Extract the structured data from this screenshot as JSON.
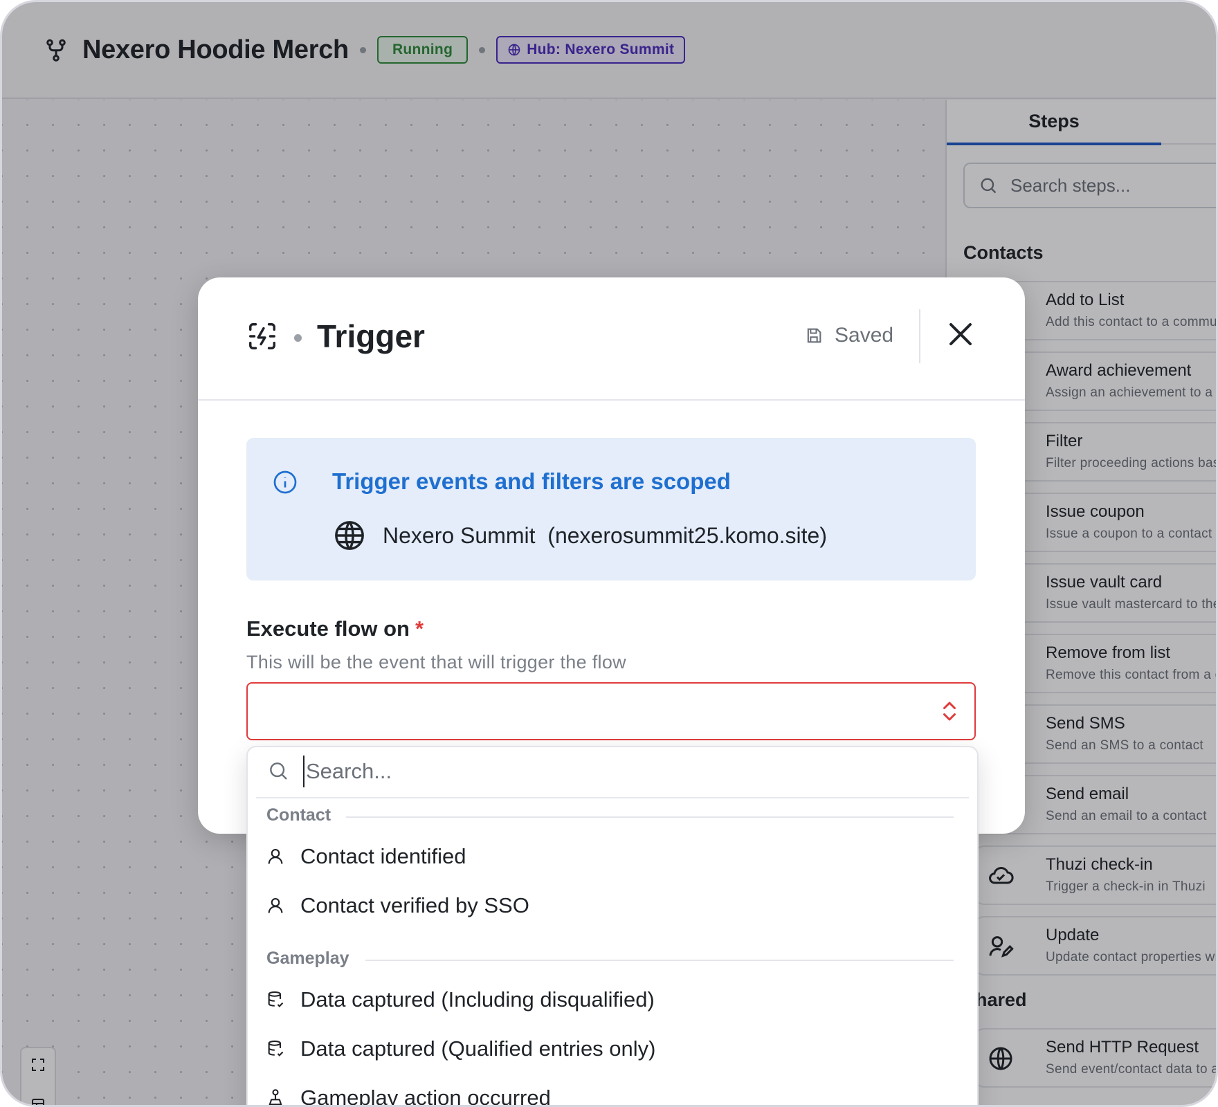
{
  "header": {
    "title": "Nexero Hoodie Merch",
    "status": "Running",
    "hub_label": "Hub: Nexero Summit",
    "status_color": "#2e8b3a",
    "hub_color": "#4b2bbf"
  },
  "steps_panel": {
    "tab_label": "Steps",
    "search_placeholder": "Search steps...",
    "sections": [
      {
        "title": "Contacts",
        "items": [
          {
            "title": "Add to List",
            "desc": "Add this contact to a community list",
            "icon": "list-add-icon"
          },
          {
            "title": "Award achievement",
            "desc": "Assign an achievement to a contact",
            "icon": "award-icon"
          },
          {
            "title": "Filter",
            "desc": "Filter proceeding actions based on conditions",
            "icon": "filter-icon"
          },
          {
            "title": "Issue coupon",
            "desc": "Issue a coupon to a contact",
            "icon": "coupon-icon"
          },
          {
            "title": "Issue vault card",
            "desc": "Issue vault mastercard to the contact",
            "icon": "card-icon"
          },
          {
            "title": "Remove from list",
            "desc": "Remove this contact from a community list",
            "icon": "list-remove-icon"
          },
          {
            "title": "Send SMS",
            "desc": "Send an SMS to a contact",
            "icon": "sms-icon"
          },
          {
            "title": "Send email",
            "desc": "Send an email to a contact",
            "icon": "mail-icon"
          },
          {
            "title": "Thuzi check-in",
            "desc": "Trigger a check-in in Thuzi",
            "icon": "cloud-icon"
          },
          {
            "title": "Update",
            "desc": "Update contact properties with values",
            "icon": "user-edit-icon"
          }
        ]
      },
      {
        "title": "Shared",
        "items": [
          {
            "title": "Send HTTP Request",
            "desc": "Send event/contact data to a URL",
            "icon": "globe-icon"
          }
        ]
      }
    ]
  },
  "modal": {
    "title": "Trigger",
    "saved_label": "Saved",
    "info": {
      "title": "Trigger events and filters are scoped",
      "site": "Nexero Summit  (nexerosummit25.komo.site)",
      "title_color": "#1f6fd0"
    },
    "field": {
      "label": "Execute flow on",
      "required_mark": "*",
      "help": "This will be the event that will trigger the flow",
      "value": ""
    }
  },
  "dropdown": {
    "search_placeholder": "Search...",
    "groups": [
      {
        "label": "Contact",
        "items": [
          {
            "label": "Contact identified",
            "icon": "user-icon"
          },
          {
            "label": "Contact verified by SSO",
            "icon": "user-icon"
          }
        ]
      },
      {
        "label": "Gameplay",
        "items": [
          {
            "label": "Data captured (Including disqualified)",
            "icon": "database-check-icon"
          },
          {
            "label": "Data captured (Qualified entries only)",
            "icon": "database-check-icon"
          },
          {
            "label": "Gameplay action occurred",
            "icon": "gameplay-icon"
          }
        ]
      }
    ]
  }
}
